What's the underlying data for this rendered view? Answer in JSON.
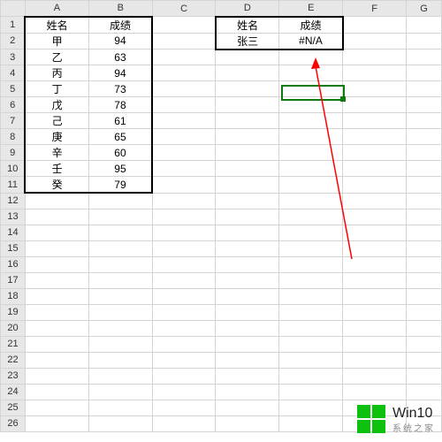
{
  "columns": [
    "A",
    "B",
    "C",
    "D",
    "E",
    "F",
    "G"
  ],
  "table1": {
    "headers": [
      "姓名",
      "成绩"
    ],
    "rows": [
      {
        "name": "甲",
        "score": 94
      },
      {
        "name": "乙",
        "score": 63
      },
      {
        "name": "丙",
        "score": 94
      },
      {
        "name": "丁",
        "score": 73
      },
      {
        "name": "戊",
        "score": 78
      },
      {
        "name": "己",
        "score": 61
      },
      {
        "name": "庚",
        "score": 65
      },
      {
        "name": "辛",
        "score": 60
      },
      {
        "name": "壬",
        "score": 95
      },
      {
        "name": "癸",
        "score": 79
      }
    ]
  },
  "table2": {
    "headers": [
      "姓名",
      "成绩"
    ],
    "row": {
      "name": "张三",
      "score": "#N/A"
    }
  },
  "active_cell_ref": "E5",
  "watermark": {
    "title": "Win10",
    "sub": "系统之家"
  },
  "visible_row_count": 26
}
